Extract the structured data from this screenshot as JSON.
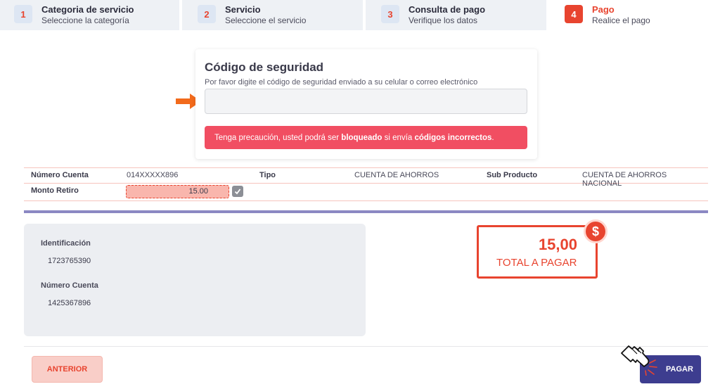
{
  "stepper": {
    "steps": [
      {
        "number": "1",
        "title": "Categoria de servicio",
        "subtitle": "Seleccione la categoría"
      },
      {
        "number": "2",
        "title": "Servicio",
        "subtitle": "Seleccione el servicio"
      },
      {
        "number": "3",
        "title": "Consulta de pago",
        "subtitle": "Verifique los datos"
      },
      {
        "number": "4",
        "title": "Pago",
        "subtitle": "Realice el pago",
        "active": true
      }
    ]
  },
  "security": {
    "title": "Código de seguridad",
    "description": "Por favor digite el código de seguridad enviado a su celular o correo electrónico",
    "input_value": "",
    "input_placeholder": "",
    "alert_prefix": "Tenga precaución, usted podrá ser ",
    "alert_bold1": "bloqueado",
    "alert_middle": " si envía ",
    "alert_bold2": "códigos incorrectos",
    "alert_suffix": ".",
    "indicator_icon": "arrow-right-icon"
  },
  "account": {
    "numero_cuenta_label": "Número Cuenta",
    "numero_cuenta_value": "014XXXXX896",
    "tipo_label": "Tipo",
    "tipo_value": "CUENTA DE AHORROS",
    "sub_producto_label": "Sub Producto",
    "sub_producto_value": "CUENTA DE AHORROS NACIONAL",
    "monto_label": "Monto Retiro",
    "monto_value": "15.00"
  },
  "details": {
    "identificacion_label": "Identificación",
    "identificacion_value": "1723765390",
    "numero_cuenta_label": "Número Cuenta",
    "numero_cuenta_value": "1425367896"
  },
  "total": {
    "amount": "15,00",
    "label": "TOTAL A PAGAR",
    "badge": "$"
  },
  "buttons": {
    "anterior": "ANTERIOR",
    "pagar": "PAGAR"
  },
  "colors": {
    "accent": "#e8442f",
    "alert": "#f14e62",
    "primary_button": "#3d3d8f",
    "separator": "#8b88c3"
  }
}
